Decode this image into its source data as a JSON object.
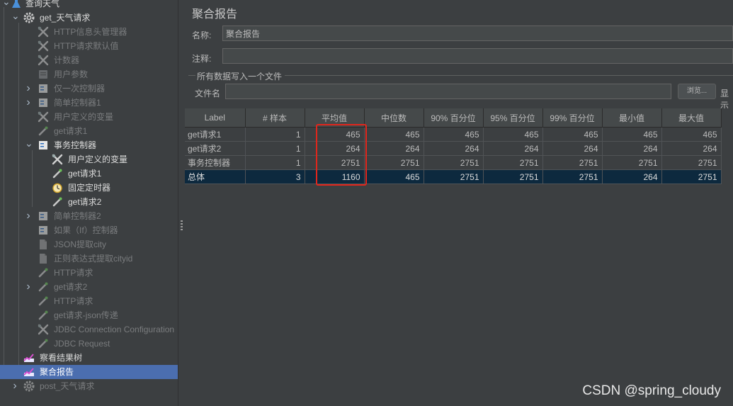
{
  "tree": {
    "items": [
      {
        "label": "查询天气",
        "icon": "flask-icon",
        "arrow": "down",
        "style": "bright"
      },
      {
        "label": "get_天气请求",
        "icon": "gear-icon",
        "arrow": "down",
        "style": "bright"
      },
      {
        "label": "HTTP信息头管理器",
        "icon": "wrench-icon",
        "style": "dim"
      },
      {
        "label": "HTTP请求默认值",
        "icon": "wrench-icon",
        "style": "dim"
      },
      {
        "label": "计数器",
        "icon": "wrench-icon",
        "style": "dim"
      },
      {
        "label": "用户参数",
        "icon": "script-icon",
        "style": "dim"
      },
      {
        "label": "仅一次控制器",
        "icon": "controller-icon",
        "arrow": "right",
        "style": "dim"
      },
      {
        "label": "简单控制器1",
        "icon": "controller-icon",
        "arrow": "right",
        "style": "dim"
      },
      {
        "label": "用户定义的变量",
        "icon": "wrench-icon",
        "style": "dim"
      },
      {
        "label": "get请求1",
        "icon": "pipette-icon",
        "style": "dim"
      },
      {
        "label": "事务控制器",
        "icon": "controller-icon",
        "arrow": "down",
        "style": "bright"
      },
      {
        "label": "用户定义的变量",
        "icon": "wrench-icon",
        "style": "bright"
      },
      {
        "label": "get请求1",
        "icon": "pipette-icon",
        "style": "bright"
      },
      {
        "label": "固定定时器",
        "icon": "timer-icon",
        "style": "bright"
      },
      {
        "label": "get请求2",
        "icon": "pipette-icon",
        "style": "bright"
      },
      {
        "label": "简单控制器2",
        "icon": "controller-icon",
        "arrow": "right",
        "style": "dim"
      },
      {
        "label": "如果（If）控制器",
        "icon": "controller-icon",
        "style": "dim"
      },
      {
        "label": "JSON提取city",
        "icon": "document-icon",
        "style": "dim"
      },
      {
        "label": "正则表达式提取cityid",
        "icon": "document-icon",
        "style": "dim"
      },
      {
        "label": "HTTP请求",
        "icon": "pipette-icon",
        "style": "dim"
      },
      {
        "label": "get请求2",
        "icon": "pipette-icon",
        "arrow": "right",
        "style": "dim"
      },
      {
        "label": "HTTP请求",
        "icon": "pipette-icon",
        "style": "dim"
      },
      {
        "label": "get请求-json传递",
        "icon": "pipette-icon",
        "style": "dim"
      },
      {
        "label": "JDBC Connection Configuration",
        "icon": "wrench-icon",
        "style": "dim"
      },
      {
        "label": "JDBC Request",
        "icon": "pipette-icon",
        "style": "dim"
      },
      {
        "label": "察看结果树",
        "icon": "chart-icon",
        "style": "bright"
      },
      {
        "label": "聚合报告",
        "icon": "chart-icon",
        "style": "bright",
        "selected": true
      },
      {
        "label": "post_天气请求",
        "icon": "gear-icon",
        "arrow": "right",
        "style": "dim"
      }
    ]
  },
  "panel": {
    "title": "聚合报告",
    "name_label": "名称:",
    "name_value": "聚合报告",
    "comment_label": "注释:",
    "comment_value": "",
    "file_section_label": "所有数据写入一个文件",
    "filename_label": "文件名",
    "filename_value": "",
    "browse_label": "浏览...",
    "display_label": "显示"
  },
  "table": {
    "columns": [
      "Label",
      "# 样本",
      "平均值",
      "中位数",
      "90% 百分位",
      "95% 百分位",
      "99% 百分位",
      "最小值",
      "最大值"
    ],
    "rows": [
      [
        "get请求1",
        "1",
        "465",
        "465",
        "465",
        "465",
        "465",
        "465",
        "465"
      ],
      [
        "get请求2",
        "1",
        "264",
        "264",
        "264",
        "264",
        "264",
        "264",
        "264"
      ],
      [
        "事务控制器",
        "1",
        "2751",
        "2751",
        "2751",
        "2751",
        "2751",
        "2751",
        "2751"
      ],
      [
        "总体",
        "3",
        "1160",
        "465",
        "2751",
        "2751",
        "2751",
        "264",
        "2751"
      ]
    ]
  },
  "watermark": "CSDN @spring_cloudy",
  "colors": {
    "background": "#3c3f41",
    "selected": "#4b6eaf",
    "total_row": "#0d293e",
    "highlight": "#e0261c"
  }
}
